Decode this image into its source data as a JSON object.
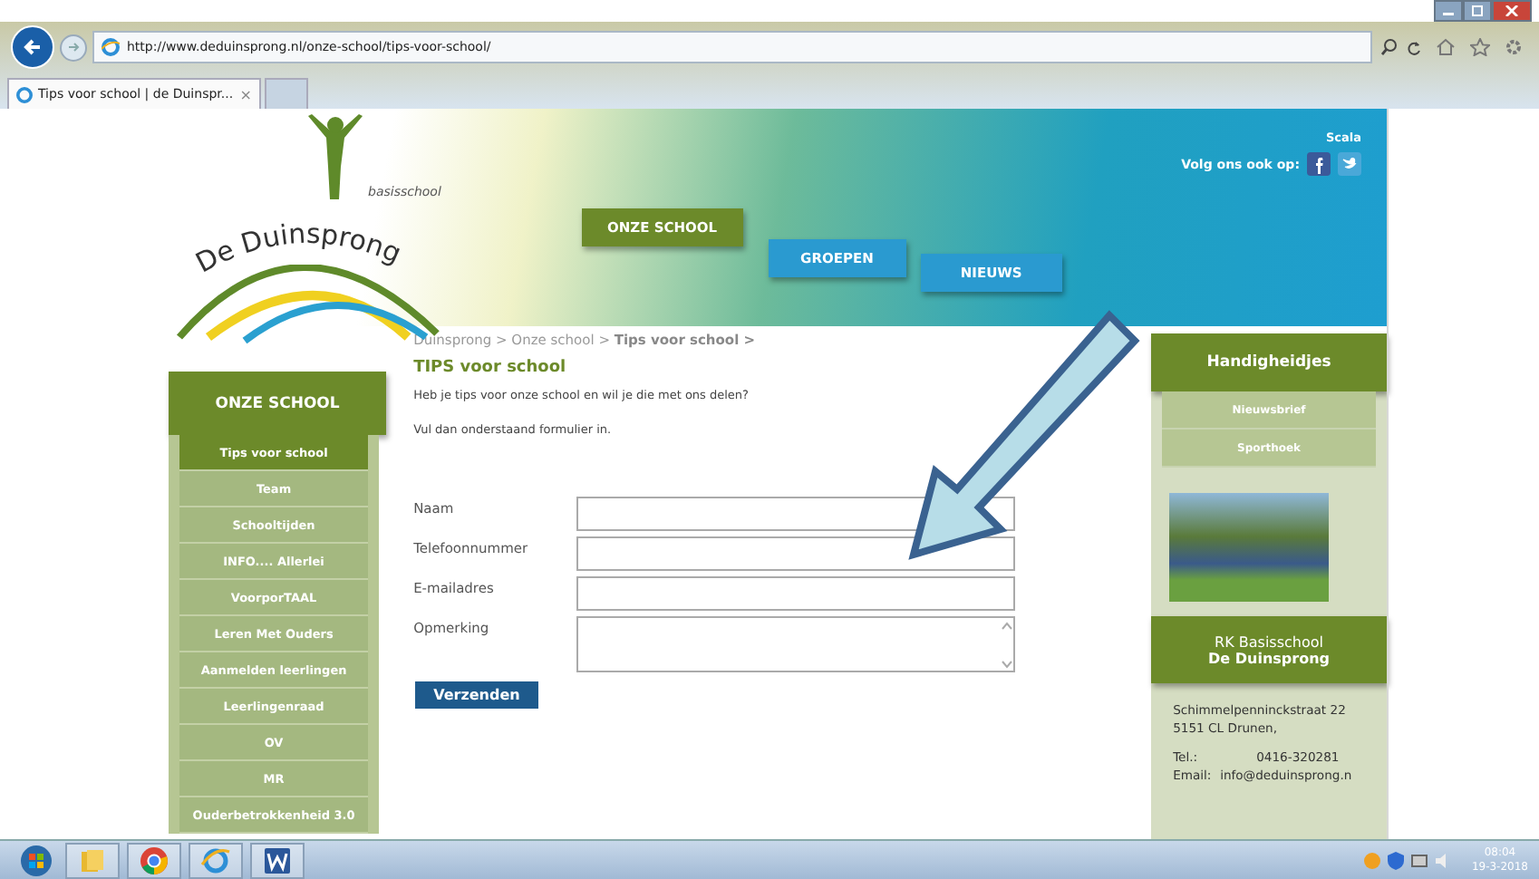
{
  "browser": {
    "address": "http://www.deduinsprong.nl/onze-school/tips-voor-school/",
    "tab": {
      "title": "Tips voor school | de Duinspr...",
      "close": "×"
    }
  },
  "header": {
    "logo_subtitle": "basisschool",
    "logo_name": "De Duinsprong",
    "scala": "Scala",
    "follow": "Volg ons ook op:",
    "nav": [
      {
        "label": "ONZE SCHOOL",
        "selected": true
      },
      {
        "label": "GROEPEN",
        "selected": false
      },
      {
        "label": "NIEUWS",
        "selected": false
      }
    ]
  },
  "breadcrumb": "Duinsprong > Onze school > **Tips voor school >**",
  "sidebar": {
    "title": "ONZE SCHOOL",
    "items": [
      {
        "label": "Tips voor school",
        "selected": true
      },
      {
        "label": "Team",
        "selected": false
      },
      {
        "label": "Schooltijden",
        "selected": false
      },
      {
        "label": "INFO.... Allerlei",
        "selected": false
      },
      {
        "label": "VoorporTAAL",
        "selected": false
      },
      {
        "label": "Leren Met Ouders",
        "selected": false
      },
      {
        "label": "Aanmelden leerlingen",
        "selected": false
      },
      {
        "label": "Leerlingenraad",
        "selected": false
      },
      {
        "label": "OV",
        "selected": false
      },
      {
        "label": "MR",
        "selected": false
      },
      {
        "label": "Ouderbetrokkenheid 3.0",
        "selected": false
      }
    ]
  },
  "content": {
    "title": "TIPS voor school",
    "intro": [
      "Heb je tips voor onze school en wil je die met ons delen?",
      "Vul dan onderstaand formulier in."
    ],
    "form": {
      "fields": [
        {
          "label": "Naam",
          "kind": "text"
        },
        {
          "label": "Telefoonnummer",
          "kind": "text"
        },
        {
          "label": "E-mailadres",
          "kind": "text"
        },
        {
          "label": "Opmerking",
          "kind": "textarea"
        }
      ],
      "submit": "Verzenden"
    }
  },
  "aside": {
    "title": "Handigheidjes",
    "links": [
      "Nieuwsbrief",
      "Sporthoek"
    ],
    "contact_title": "RK Basisschool",
    "contact_name": "De Duinsprong",
    "address": [
      "Schimmelpenninckstraat 22",
      "5151 CL Drunen,"
    ],
    "contacts": [
      {
        "label": "Tel.:",
        "value": "0416-320281"
      },
      {
        "label": "Email:",
        "value": "info@deduinsprong.n"
      }
    ]
  },
  "taskbar": {
    "time": "08:04",
    "date": "19-3-2018"
  }
}
